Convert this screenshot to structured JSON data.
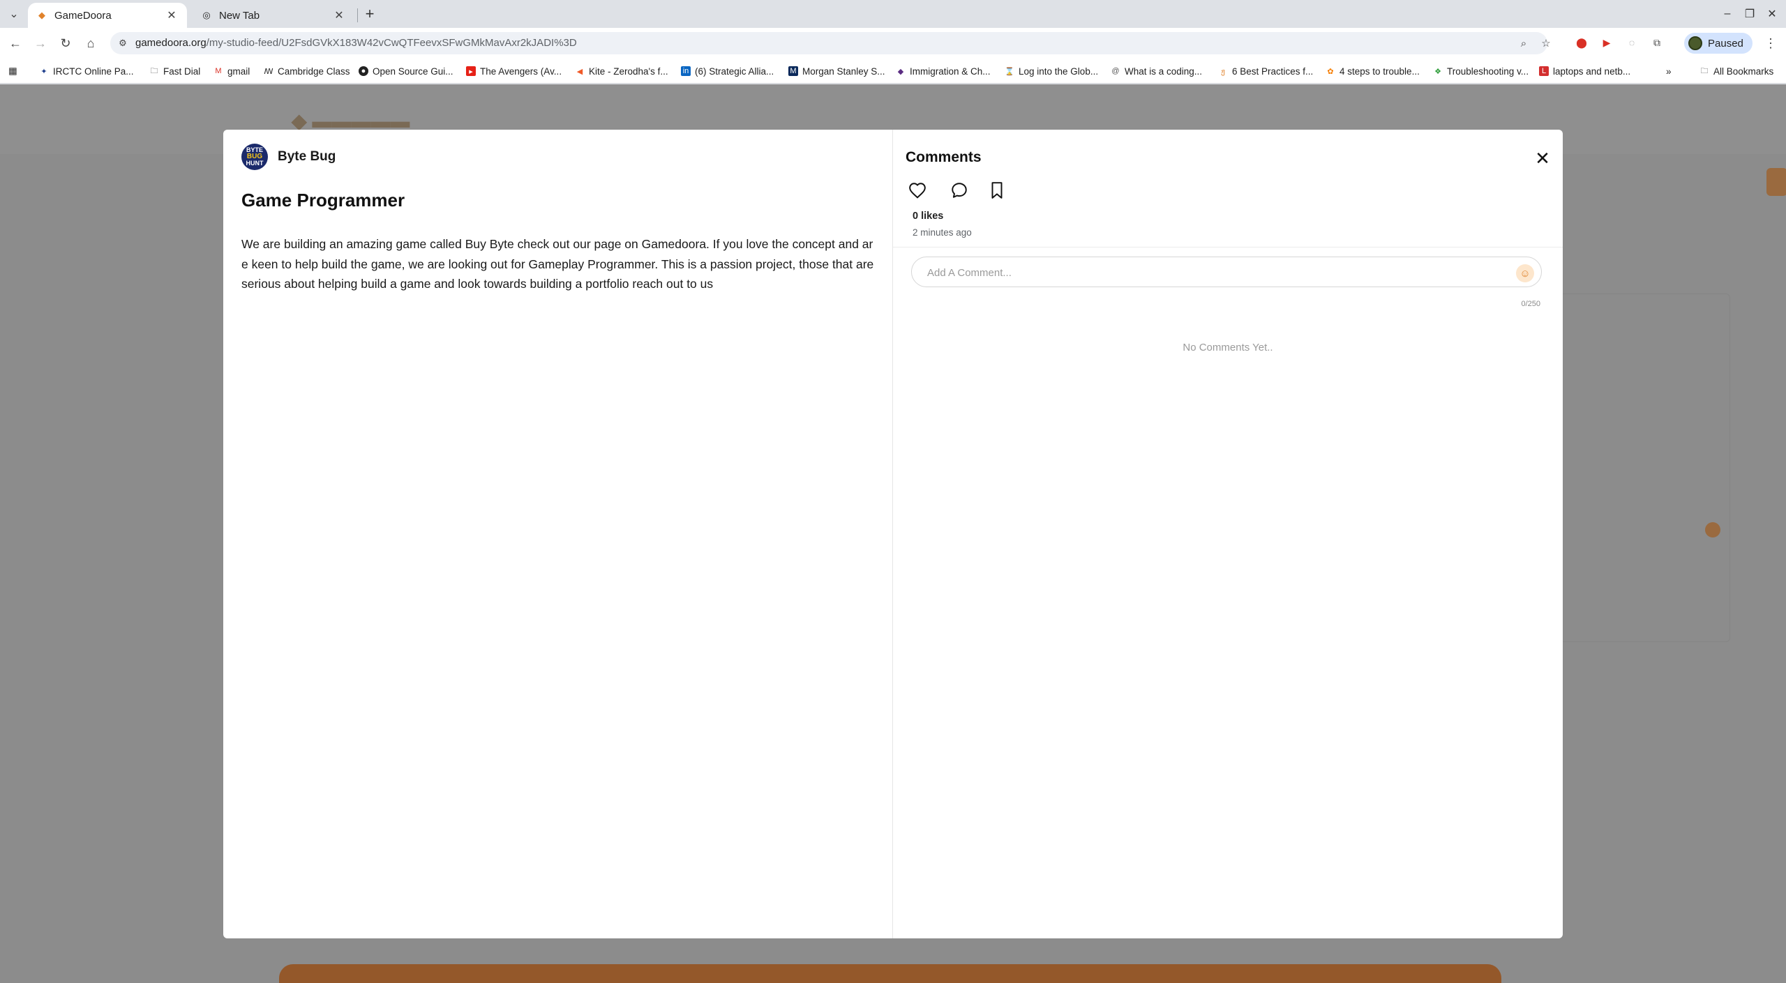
{
  "browser": {
    "tabs": [
      {
        "title": "GameDoora",
        "active": true,
        "icon": "gamedoora-favicon"
      },
      {
        "title": "New Tab",
        "active": false,
        "icon": "chrome-icon"
      }
    ],
    "url": {
      "host": "gamedoora.org",
      "path": "/my-studio-feed/U2FsdGVkX183W42vCwQTFeevxSFwGMkMavAxr2kJADI%3D"
    },
    "profile_status": "Paused",
    "bookmarks": [
      {
        "label": "IRCTC Online Pa...",
        "icon": "irctc-icon"
      },
      {
        "label": "Fast Dial",
        "icon": "folder-icon"
      },
      {
        "label": "gmail",
        "icon": "gmail-icon"
      },
      {
        "label": "Cambridge Class",
        "icon": "cambridge-icon"
      },
      {
        "label": "Open Source Gui...",
        "icon": "github-icon"
      },
      {
        "label": "The Avengers (Av...",
        "icon": "youtube-icon"
      },
      {
        "label": "Kite - Zerodha's f...",
        "icon": "kite-icon"
      },
      {
        "label": "(6) Strategic Allia...",
        "icon": "linkedin-icon"
      },
      {
        "label": "Morgan Stanley S...",
        "icon": "morgan-stanley-icon"
      },
      {
        "label": "Immigration & Ch...",
        "icon": "immigration-icon"
      },
      {
        "label": "Log into the Glob...",
        "icon": "globe-icon"
      },
      {
        "label": "What is a coding...",
        "icon": "coding-icon"
      },
      {
        "label": "6 Best Practices f...",
        "icon": "practices-icon"
      },
      {
        "label": "4 steps to trouble...",
        "icon": "steps-icon"
      },
      {
        "label": "Troubleshooting v...",
        "icon": "troubleshooting-icon"
      },
      {
        "label": "laptops and netb...",
        "icon": "laptops-icon"
      }
    ],
    "all_bookmarks_label": "All Bookmarks"
  },
  "modal": {
    "author": {
      "name": "Byte Bug",
      "avatar_text": [
        "BYTE",
        "BUG",
        "HUNT"
      ]
    },
    "post": {
      "title": "Game Programmer",
      "body": "We are building an amazing game called Buy Byte check out our page on Gamedoora. If you love the concept and are keen to help build the game, we are looking out for Gameplay Programmer. This is a passion project, those that are  serious about helping build a game and look towards building a portfolio reach out to us"
    },
    "comments": {
      "title": "Comments",
      "likes": "0 likes",
      "time_ago": "2 minutes ago",
      "input_placeholder": "Add A Comment...",
      "char_count": "0/250",
      "empty_text": "No Comments Yet.."
    }
  },
  "colors": {
    "backdrop": "#8c8c8c",
    "accent_orange": "#e0822b",
    "omnibox": "#eef1f6",
    "paused_chip": "#d3e3fd"
  }
}
